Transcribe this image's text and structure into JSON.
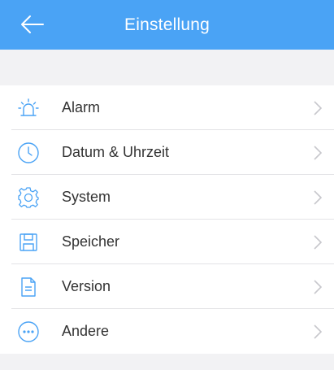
{
  "header": {
    "title": "Einstellung",
    "back_icon": "arrow-left-icon"
  },
  "colors": {
    "header_bg": "#4aa3f5",
    "icon_blue": "#4aa3f5",
    "chevron": "#c7c7cc",
    "background": "#f2f2f4"
  },
  "menu": {
    "items": [
      {
        "label": "Alarm",
        "icon": "alarm-siren-icon"
      },
      {
        "label": "Datum & Uhrzeit",
        "icon": "clock-icon"
      },
      {
        "label": "System",
        "icon": "gear-icon"
      },
      {
        "label": "Speicher",
        "icon": "floppy-disk-icon"
      },
      {
        "label": "Version",
        "icon": "document-icon"
      },
      {
        "label": "Andere",
        "icon": "more-dots-icon"
      }
    ]
  }
}
